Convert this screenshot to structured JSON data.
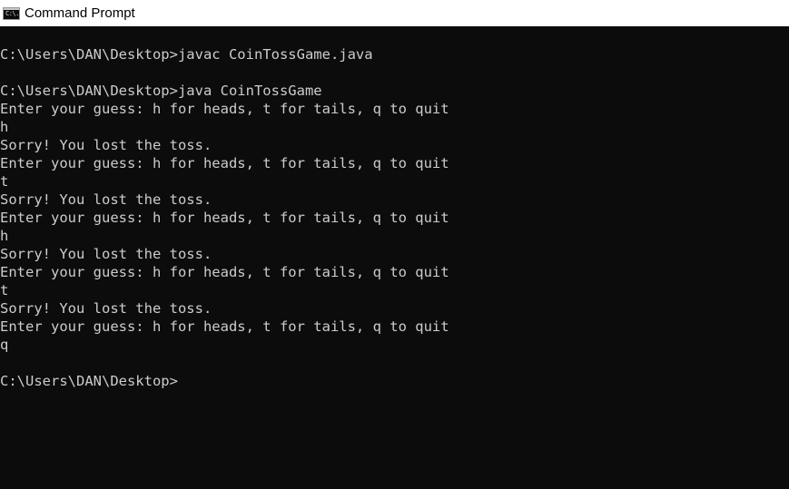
{
  "window": {
    "title": "Command Prompt",
    "icon": "cmd-icon",
    "icon_text": "C:\\."
  },
  "console": {
    "lines": [
      "",
      "C:\\Users\\DAN\\Desktop>javac CoinTossGame.java",
      "",
      "C:\\Users\\DAN\\Desktop>java CoinTossGame",
      "Enter your guess: h for heads, t for tails, q to quit",
      "h",
      "Sorry! You lost the toss.",
      "Enter your guess: h for heads, t for tails, q to quit",
      "t",
      "Sorry! You lost the toss.",
      "Enter your guess: h for heads, t for tails, q to quit",
      "h",
      "Sorry! You lost the toss.",
      "Enter your guess: h for heads, t for tails, q to quit",
      "t",
      "Sorry! You lost the toss.",
      "Enter your guess: h for heads, t for tails, q to quit",
      "q",
      "",
      "C:\\Users\\DAN\\Desktop>"
    ]
  },
  "colors": {
    "background": "#0c0c0c",
    "foreground": "#cccccc",
    "titlebar": "#ffffff"
  }
}
